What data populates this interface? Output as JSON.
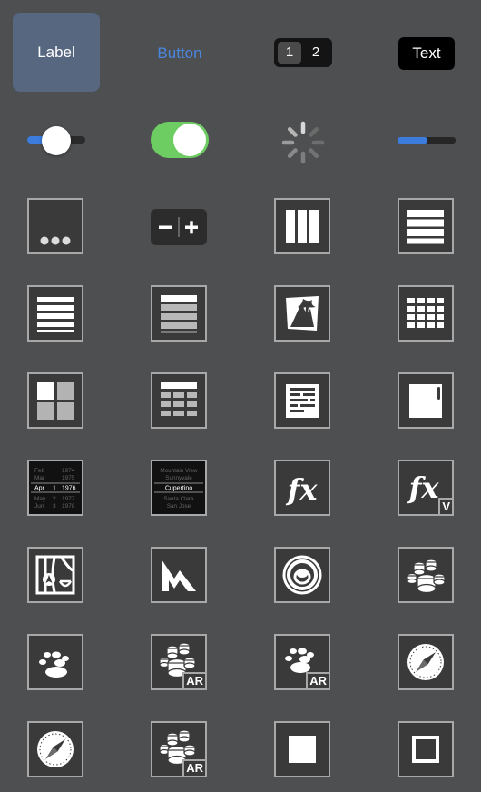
{
  "palette": {
    "label": "Label",
    "button": "Button",
    "segments": [
      "1",
      "2"
    ],
    "text_field": "Text",
    "date_picker": {
      "rows": [
        {
          "month": "Feb",
          "day": "",
          "year": "1974"
        },
        {
          "month": "Mar",
          "day": "",
          "year": "1975"
        },
        {
          "month": "Apr",
          "day": "1",
          "year": "1976"
        },
        {
          "month": "May",
          "day": "2",
          "year": "1977"
        },
        {
          "month": "Jun",
          "day": "3",
          "year": "1978"
        }
      ]
    },
    "picker": {
      "items": [
        "Mountain View",
        "Sunnyvale",
        "Cupertino",
        "Santa Clara",
        "San Jose"
      ]
    },
    "badges": {
      "formula_variable": "V",
      "ar1": "AR",
      "ar2": "AR",
      "ar3": "AR"
    }
  },
  "icons": [
    "label",
    "button",
    "segmented-control",
    "text-field",
    "slider",
    "switch",
    "activity-indicator",
    "progress-view",
    "more",
    "stepper",
    "column-view",
    "table-view",
    "stack-view",
    "collection-view",
    "image-view",
    "grid",
    "split-view",
    "form-table",
    "text-view",
    "scroll-view",
    "date-picker",
    "picker",
    "formula",
    "formula-variable",
    "map-view",
    "metal-view",
    "ar-object",
    "scenekit-view",
    "particles",
    "ar-scenekit",
    "ar-particles",
    "safari-view",
    "web-view",
    "ar-scene",
    "filled-square",
    "hollow-square"
  ],
  "colors": {
    "background": "#4e4f50",
    "accent_blue": "#3b7cdc",
    "switch_green": "#6dcd62",
    "selection": "#56677f"
  },
  "states": {
    "slider_value": 0.5,
    "switch_on": true,
    "progress": 0.5
  }
}
